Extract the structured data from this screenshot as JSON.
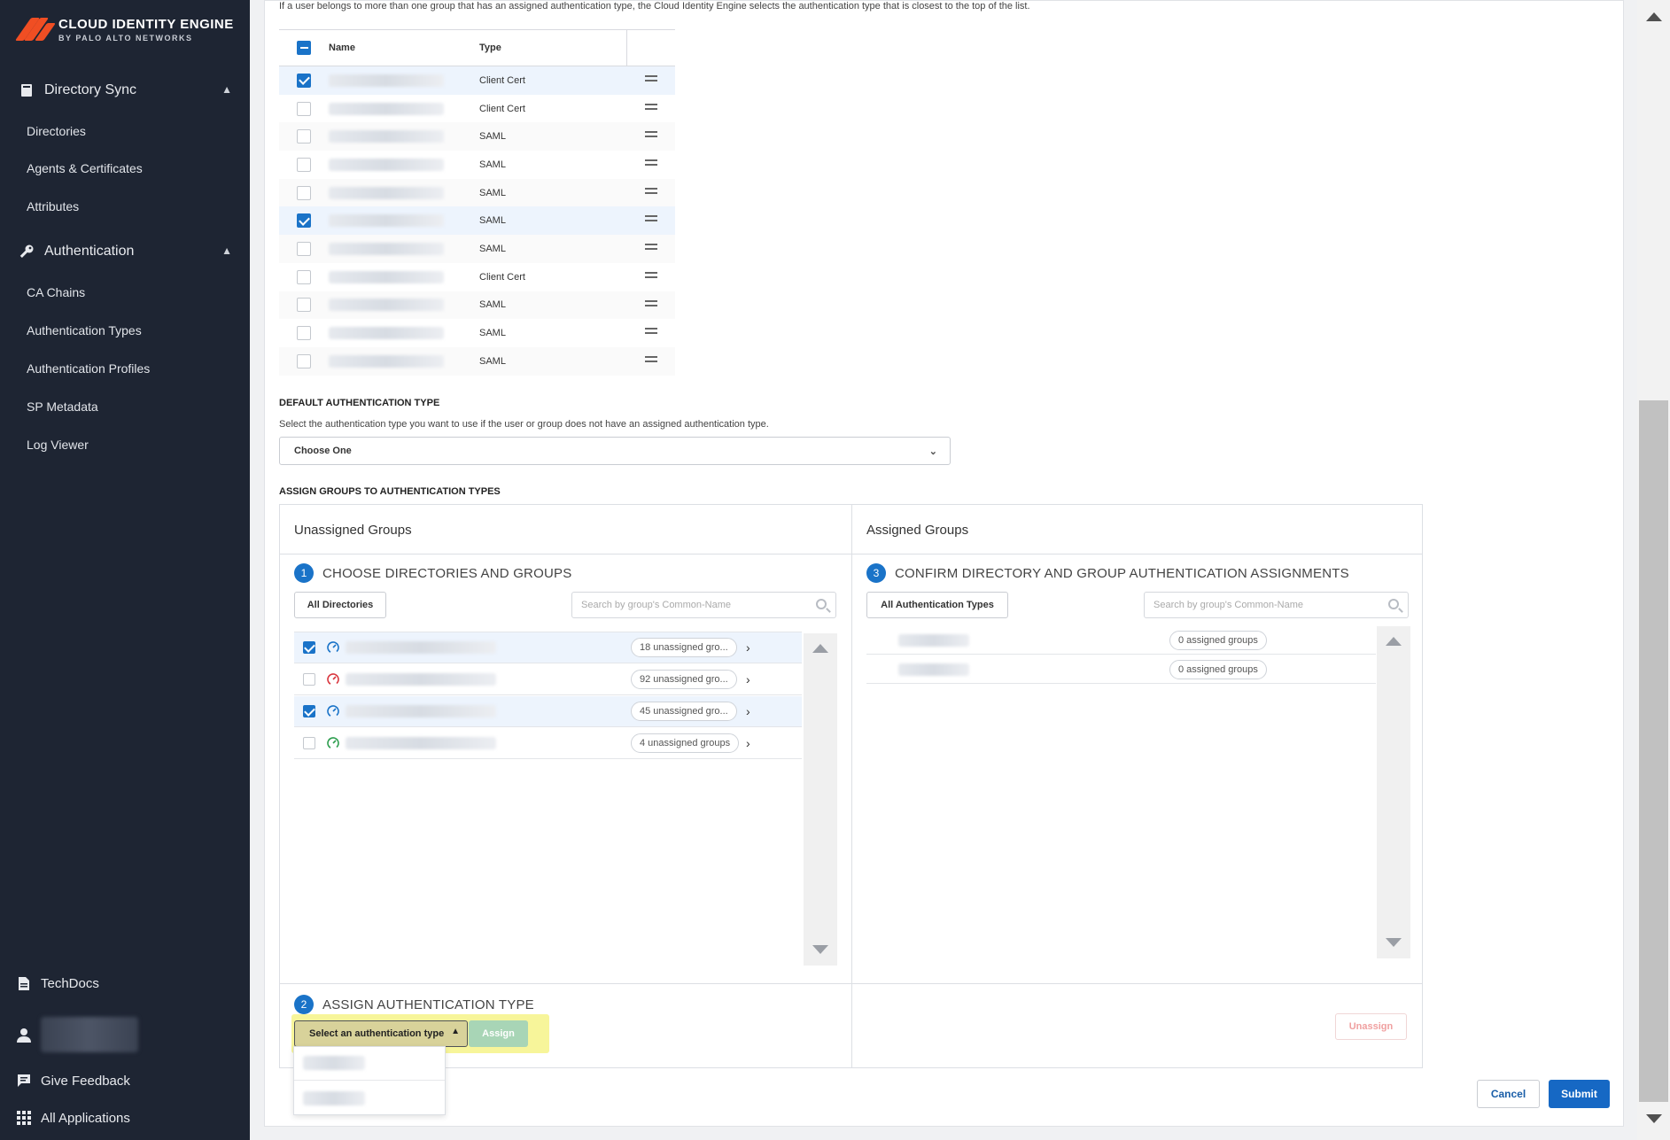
{
  "brand": {
    "name": "CLOUD IDENTITY ENGINE",
    "tagline": "BY PALO ALTO NETWORKS",
    "accent": "#f04e23"
  },
  "sidebar": {
    "sections": [
      {
        "label": "Directory Sync",
        "icon": "book-icon",
        "expanded": true,
        "items": [
          {
            "label": "Directories"
          },
          {
            "label": "Agents & Certificates"
          },
          {
            "label": "Attributes"
          }
        ]
      },
      {
        "label": "Authentication",
        "icon": "key-icon",
        "expanded": true,
        "items": [
          {
            "label": "CA Chains"
          },
          {
            "label": "Authentication Types"
          },
          {
            "label": "Authentication Profiles"
          },
          {
            "label": "SP Metadata"
          },
          {
            "label": "Log Viewer"
          }
        ]
      }
    ],
    "bottom": [
      {
        "label": "TechDocs",
        "icon": "document-icon"
      },
      {
        "label": "Give Feedback",
        "icon": "chat-icon"
      },
      {
        "label": "All Applications",
        "icon": "grid-icon"
      }
    ],
    "background": "#1e2533"
  },
  "priority": {
    "intro": "If a user belongs to more than one group that has an assigned authentication type, the Cloud Identity Engine selects the authentication type that is closest to the top of the list.",
    "columns": {
      "name": "Name",
      "type": "Type"
    },
    "rows": [
      {
        "type": "Client Cert",
        "checked": true
      },
      {
        "type": "Client Cert",
        "checked": false
      },
      {
        "type": "SAML",
        "checked": false
      },
      {
        "type": "SAML",
        "checked": false
      },
      {
        "type": "SAML",
        "checked": false
      },
      {
        "type": "SAML",
        "checked": true
      },
      {
        "type": "SAML",
        "checked": false
      },
      {
        "type": "Client Cert",
        "checked": false
      },
      {
        "type": "SAML",
        "checked": false
      },
      {
        "type": "SAML",
        "checked": false
      },
      {
        "type": "SAML",
        "checked": false
      }
    ]
  },
  "default_auth": {
    "heading": "DEFAULT AUTHENTICATION TYPE",
    "description": "Select the authentication type you want to use if the user or group does not have an assigned authentication type.",
    "selected": "Choose One"
  },
  "assign": {
    "heading": "ASSIGN GROUPS TO AUTHENTICATION TYPES",
    "unassigned_title": "Unassigned Groups",
    "assigned_title": "Assigned Groups",
    "step1": {
      "num": "1",
      "label": "CHOOSE DIRECTORIES AND GROUPS"
    },
    "step2": {
      "num": "2",
      "label": "ASSIGN AUTHENTICATION TYPE"
    },
    "step3": {
      "num": "3",
      "label": "CONFIRM DIRECTORY AND GROUP AUTHENTICATION ASSIGNMENTS"
    },
    "dir_filter": "All Directories",
    "type_filter": "All Authentication Types",
    "search_placeholder": "Search by group's Common-Name",
    "directories": [
      {
        "count": "18 unassigned gro...",
        "checked": true,
        "status_color": "#1a73c8"
      },
      {
        "count": "92 unassigned gro...",
        "checked": false,
        "status_color": "#d9363e"
      },
      {
        "count": "45 unassigned gro...",
        "checked": true,
        "status_color": "#1a73c8"
      },
      {
        "count": "4 unassigned groups",
        "checked": false,
        "status_color": "#2e9e4f"
      }
    ],
    "assigned": [
      {
        "count": "0 assigned groups"
      },
      {
        "count": "0 assigned groups"
      }
    ],
    "auth_select_placeholder": "Select an authentication type",
    "assign_label": "Assign",
    "unassign_label": "Unassign"
  },
  "actions": {
    "cancel": "Cancel",
    "submit": "Submit"
  }
}
